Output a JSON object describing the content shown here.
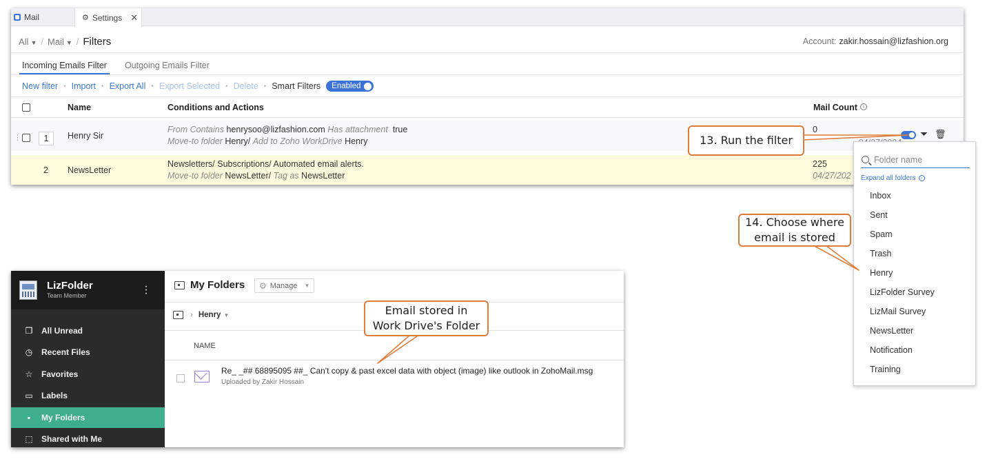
{
  "mail": {
    "tabs": [
      {
        "label": "Mail"
      },
      {
        "label": "Settings"
      }
    ],
    "breadcrumb": {
      "all": "All",
      "mail": "Mail",
      "current": "Filters"
    },
    "account": {
      "label": "Account:",
      "value": "zakir.hossain@lizfashion.org"
    },
    "filter_tabs": [
      "Incoming Emails Filter",
      "Outgoing Emails Filter"
    ],
    "toolbar": {
      "new_filter": "New filter",
      "import": "Import",
      "export_all": "Export All",
      "export_selected": "Export Selected",
      "delete": "Delete",
      "smart_filters": "Smart Filters",
      "enabled": "Enabled"
    },
    "columns": {
      "name": "Name",
      "conditions": "Conditions and Actions",
      "mail_count": "Mail Count"
    },
    "rows": [
      {
        "num": "1",
        "name": "Henry Sir",
        "cond_l1_a": "From Contains",
        "cond_l1_b": "henrysoo@lizfashion.com",
        "cond_l1_c": "Has attachment",
        "cond_l1_d": "true",
        "cond_l2_a": "Move-to folder",
        "cond_l2_b": "Henry/",
        "cond_l2_c": "Add to Zoho WorkDrive",
        "cond_l2_d": "Henry",
        "count": "0",
        "date": "04/27/2024"
      },
      {
        "num": "2",
        "name": "NewsLetter",
        "cond_l1_a": "Newsletters/ Subscriptions/ Automated email alerts.",
        "cond_l2_a": "Move-to folder",
        "cond_l2_b": "NewsLetter/",
        "cond_l2_c": "Tag as",
        "cond_l2_d": "NewsLetter",
        "count": "225",
        "date": "04/27/202"
      }
    ]
  },
  "folder_picker": {
    "placeholder": "Folder name",
    "expand_all": "Expand all folders",
    "folders": [
      "Inbox",
      "Sent",
      "Spam",
      "Trash",
      "Henry",
      "LizFolder Survey",
      "LizMail Survey",
      "NewsLetter",
      "Notification",
      "Training"
    ]
  },
  "callouts": {
    "run_filter": "13. Run the filter",
    "choose_where_l1": "14. Choose where",
    "choose_where_l2": "email is stored",
    "stored_l1": "Email stored in",
    "stored_l2": "Work Drive's Folder"
  },
  "workdrive": {
    "app_name": "LizFolder",
    "role": "Team Member",
    "sidebar": [
      "All Unread",
      "Recent Files",
      "Favorites",
      "Labels",
      "My Folders",
      "Shared with Me"
    ],
    "title": "My Folders",
    "manage": "Manage",
    "crumb": "Henry",
    "column_name": "NAME",
    "file_name": "Re_ _## 68895095 ##_ Can't copy & past excel data with object (image) like outlook in ZohoMail.msg",
    "uploaded_by": "Uploaded by Zakir Hossain"
  },
  "colors": {
    "accent": "#3b73d9",
    "callout_border": "#e07b39",
    "workdrive_active": "#3fae8c",
    "highlight_row": "#fffbdc"
  }
}
